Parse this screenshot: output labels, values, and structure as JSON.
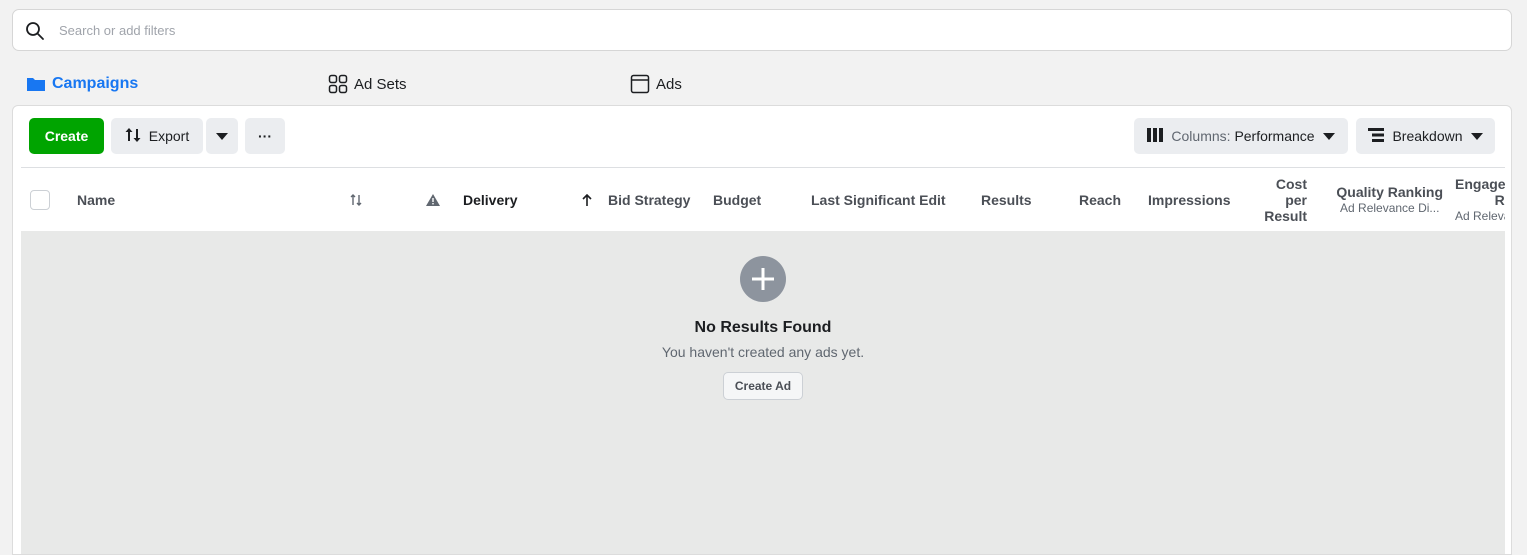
{
  "search": {
    "placeholder": "Search or add filters",
    "icon": "search-icon"
  },
  "levels": [
    {
      "label": "Campaigns",
      "icon": "folder-icon",
      "active": true
    },
    {
      "label": "Ad Sets",
      "icon": "grid-icon",
      "active": false
    },
    {
      "label": "Ads",
      "icon": "ad-window-icon",
      "active": false
    }
  ],
  "toolbar": {
    "create_label": "Create",
    "export_label": "Export",
    "more_label": "···",
    "columns_prefix": "Columns:",
    "columns_value": "Performance",
    "breakdown_label": "Breakdown"
  },
  "table": {
    "headers": {
      "name": "Name",
      "delivery": "Delivery",
      "bid_strategy": "Bid Strategy",
      "budget": "Budget",
      "last_edit": "Last Significant Edit",
      "results": "Results",
      "reach": "Reach",
      "impressions": "Impressions",
      "cost_per_result_1": "Cost per",
      "cost_per_result_2": "Result",
      "quality_ranking": "Quality Ranking",
      "quality_ranking_sub": "Ad Relevance Di...",
      "engagement_1": "Engagement",
      "engagement_2": "Rate",
      "engagement_sub": "Ad Relevance Diagnostic"
    }
  },
  "empty": {
    "title": "No Results Found",
    "subtitle": "You haven't created any ads yet.",
    "button": "Create Ad"
  },
  "colors": {
    "accent": "#1877f2",
    "create_green": "#00a400",
    "empty_bg": "#e8e9e8"
  }
}
